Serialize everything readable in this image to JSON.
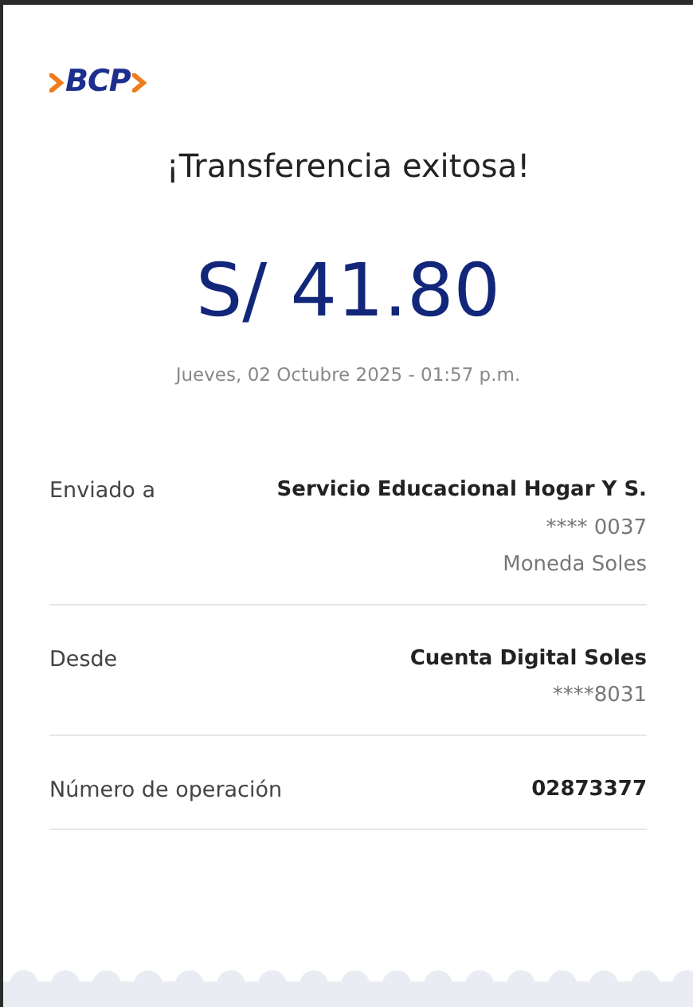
{
  "logo": {
    "text": "BCP"
  },
  "title": "¡Transferencia exitosa!",
  "amount": "S/ 41.80",
  "date": "Jueves, 02 Octubre 2025 - 01:57 p.m.",
  "details": [
    {
      "label": "Enviado a",
      "value": "Servicio Educacional Hogar Y S.",
      "extra": [
        "**** 0037",
        "Moneda Soles"
      ]
    },
    {
      "label": "Desde",
      "value": "Cuenta Digital Soles",
      "extra": [
        "****8031"
      ]
    },
    {
      "label": "Número de operación",
      "value": "02873377"
    }
  ]
}
